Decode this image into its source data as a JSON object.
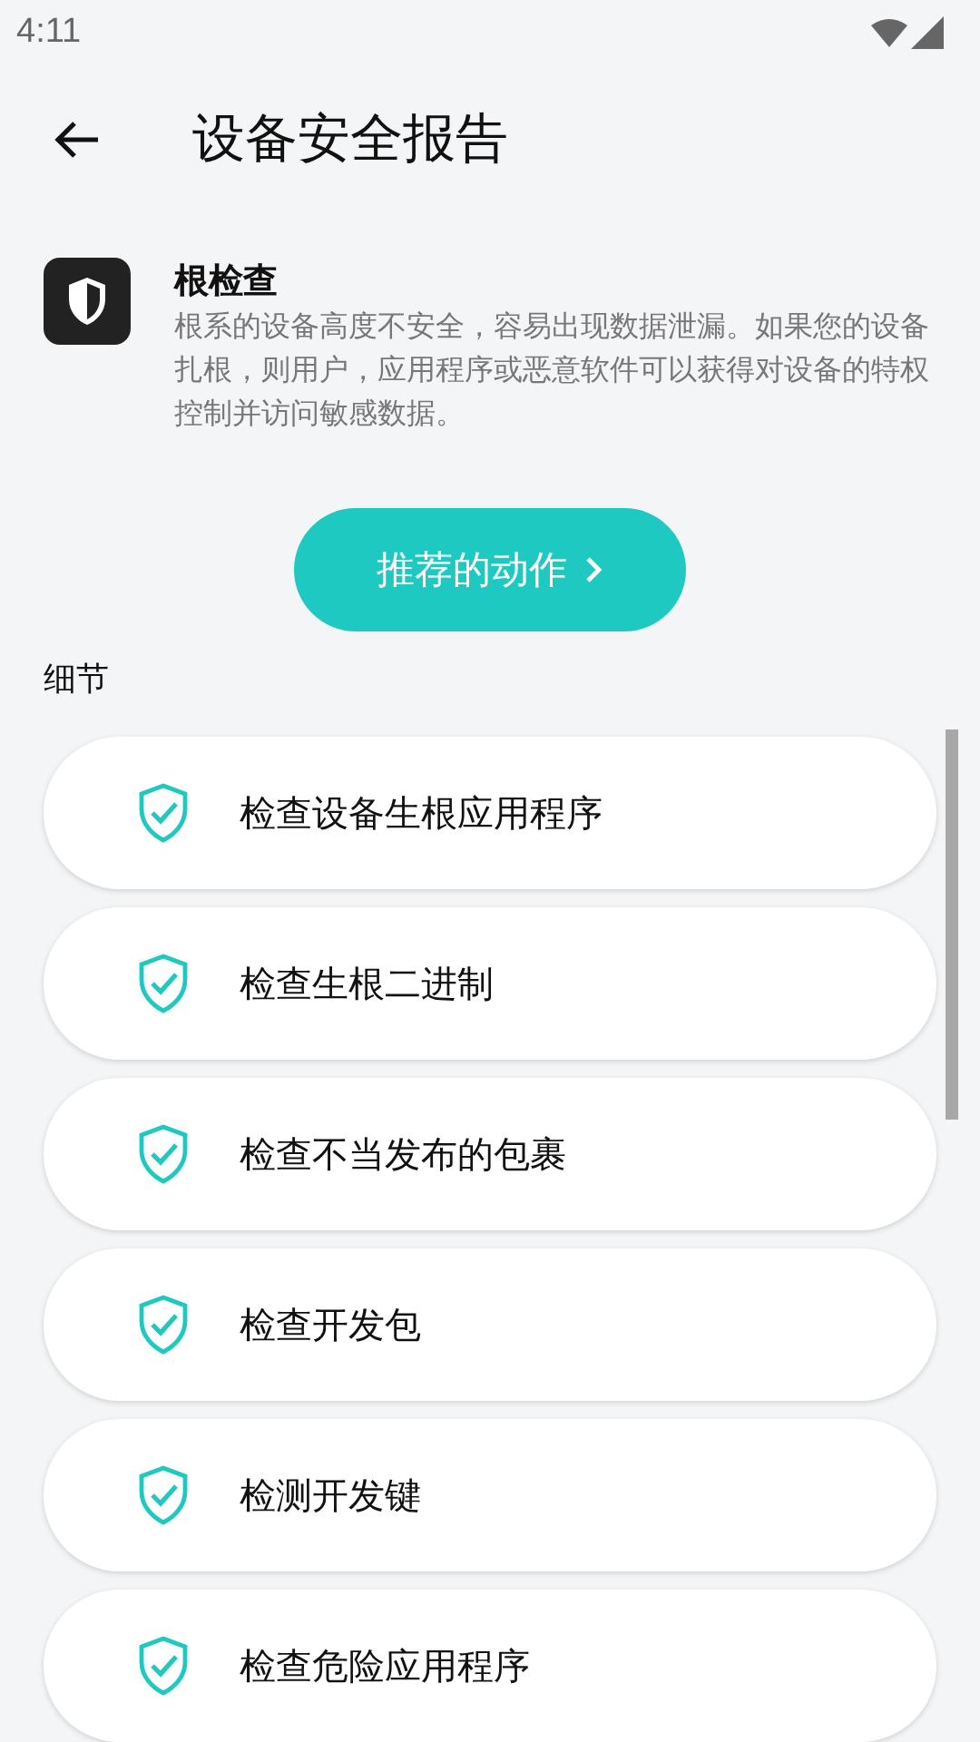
{
  "status_bar": {
    "time": "4:11"
  },
  "header": {
    "title": "设备安全报告"
  },
  "summary": {
    "title": "根检查",
    "description": "根系的设备高度不安全，容易出现数据泄漏。如果您的设备扎根，则用户，应用程序或恶意软件可以获得对设备的特权控制并访问敏感数据。"
  },
  "action_button": {
    "label": "推荐的动作"
  },
  "section": {
    "title": "细节"
  },
  "checks": [
    {
      "label": "检查设备生根应用程序",
      "passed": true
    },
    {
      "label": "检查生根二进制",
      "passed": true
    },
    {
      "label": "检查不当发布的包裹",
      "passed": true
    },
    {
      "label": "检查开发包",
      "passed": true
    },
    {
      "label": "检测开发键",
      "passed": true
    },
    {
      "label": "检查危险应用程序",
      "passed": true
    }
  ]
}
